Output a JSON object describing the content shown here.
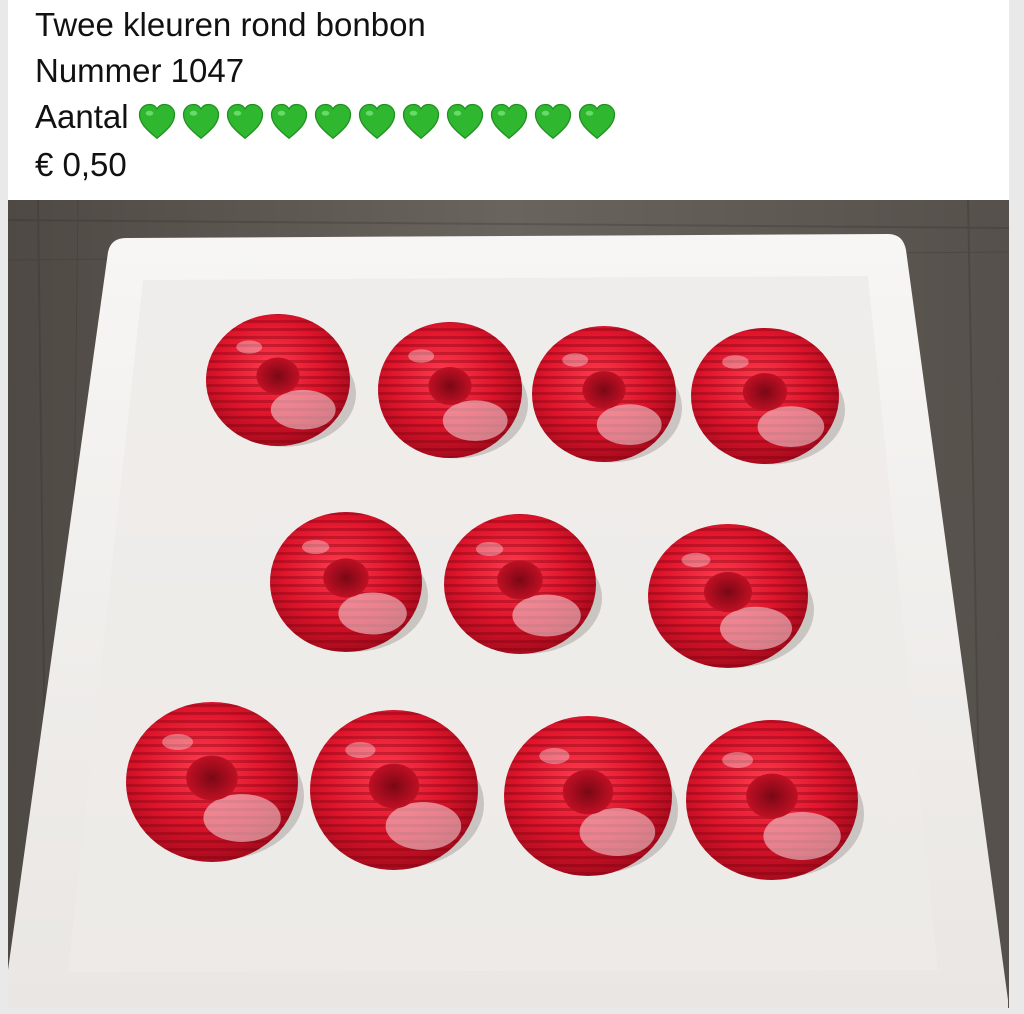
{
  "post": {
    "title": "Twee kleuren rond bonbon",
    "number_label": "Nummer 1047",
    "quantity_label": "Aantal",
    "quantity_hearts": 11,
    "heart_icon": "green-heart-icon",
    "price": "€ 0,50"
  },
  "colors": {
    "heart": "#2fb82f",
    "bonbon_red": "#e0142b",
    "plate": "#f2f0ee",
    "table": "#5a5550"
  },
  "photo": {
    "subject": "bonbons on plate",
    "bonbon_count": 11
  }
}
